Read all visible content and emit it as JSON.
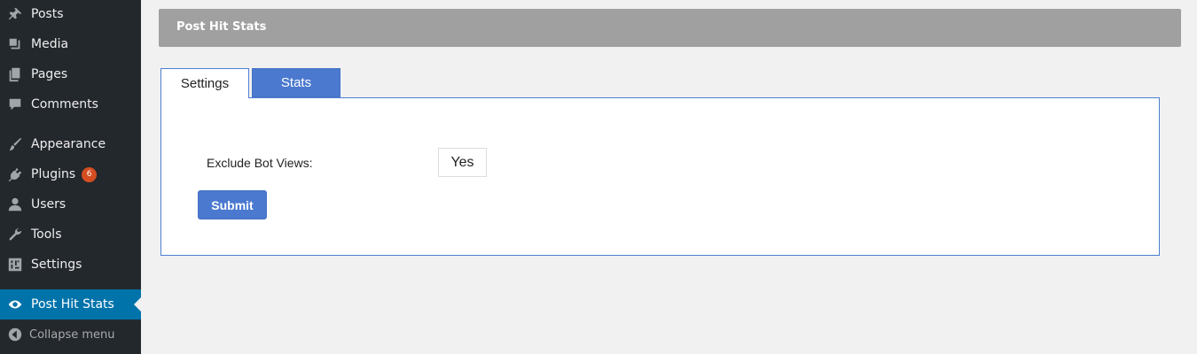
{
  "sidebar": {
    "items": [
      {
        "label": "Posts",
        "icon": "pin-icon"
      },
      {
        "label": "Media",
        "icon": "media-icon"
      },
      {
        "label": "Pages",
        "icon": "pages-icon"
      },
      {
        "label": "Comments",
        "icon": "comment-icon"
      },
      {
        "label": "Appearance",
        "icon": "brush-icon"
      },
      {
        "label": "Plugins",
        "icon": "plugin-icon",
        "badge": "6"
      },
      {
        "label": "Users",
        "icon": "user-icon"
      },
      {
        "label": "Tools",
        "icon": "wrench-icon"
      },
      {
        "label": "Settings",
        "icon": "settings-icon"
      },
      {
        "label": "Post Hit Stats",
        "icon": "eye-icon",
        "current": true
      }
    ],
    "collapse_label": "Collapse menu"
  },
  "header": {
    "title": "Post Hit Stats"
  },
  "tabs": [
    {
      "label": "Settings",
      "active": true
    },
    {
      "label": "Stats",
      "active": false
    }
  ],
  "form": {
    "exclude_bot_views_label": "Exclude Bot Views:",
    "exclude_bot_views_value": "Yes",
    "submit_label": "Submit"
  },
  "colors": {
    "sidebar_bg": "#23282d",
    "current_menu_bg": "#0073aa",
    "accent_blue": "#4b79cf",
    "badge": "#d54e21",
    "header_bar": "#a0a0a0"
  }
}
